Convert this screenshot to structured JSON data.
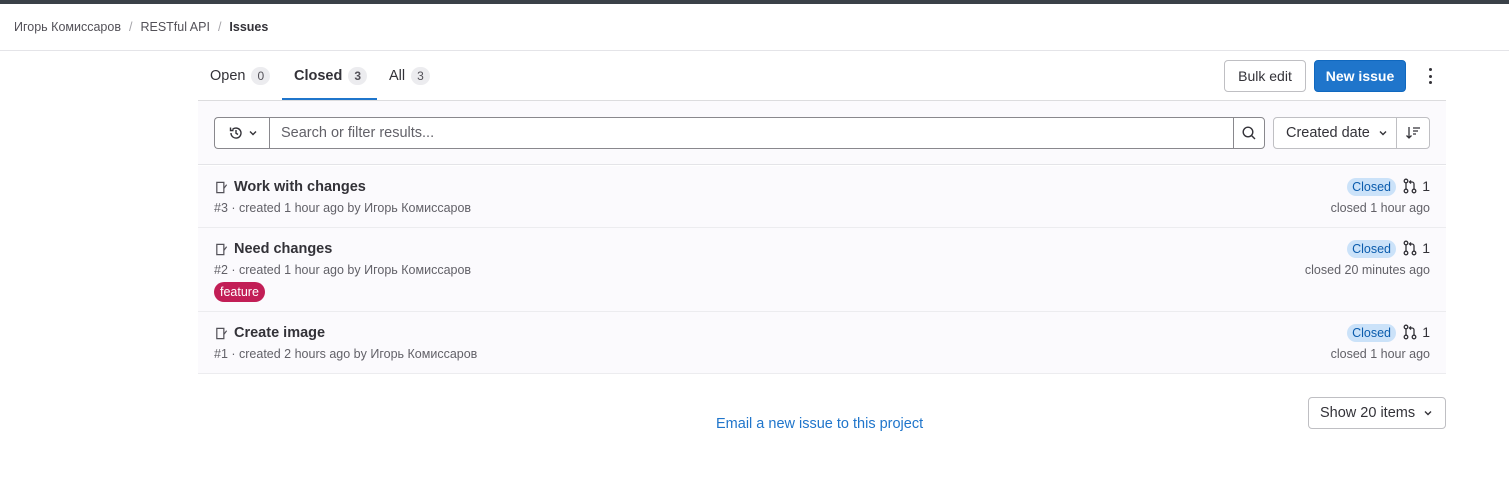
{
  "breadcrumb": {
    "items": [
      "Игорь Комиссаров",
      "RESTful API",
      "Issues"
    ],
    "separator": "/"
  },
  "tabs": [
    {
      "label": "Open",
      "count": "0",
      "active": false
    },
    {
      "label": "Closed",
      "count": "3",
      "active": true
    },
    {
      "label": "All",
      "count": "3",
      "active": false
    }
  ],
  "actions": {
    "bulk_edit": "Bulk edit",
    "new_issue": "New issue",
    "more_icon": "ellipsis-vertical-icon"
  },
  "filter": {
    "history_icon": "history-icon",
    "placeholder": "Search or filter results...",
    "value": "",
    "search_icon": "search-icon",
    "sort_label": "Created date",
    "sort_direction_icon": "sort-descending-icon"
  },
  "issues": [
    {
      "title": "Work with changes",
      "meta": "#3 · created 1 hour ago by Игорь Комиссаров",
      "status": "Closed",
      "mr_count": "1",
      "closed_time": "closed 1 hour ago",
      "labels": []
    },
    {
      "title": "Need changes",
      "meta": "#2 · created 1 hour ago by Игорь Комиссаров",
      "status": "Closed",
      "mr_count": "1",
      "closed_time": "closed 20 minutes ago",
      "labels": [
        "feature"
      ]
    },
    {
      "title": "Create image",
      "meta": "#1 · created 2 hours ago by Игорь Комиссаров",
      "status": "Closed",
      "mr_count": "1",
      "closed_time": "closed 1 hour ago",
      "labels": []
    }
  ],
  "colors": {
    "accent": "#1f75cb",
    "closed_badge_bg": "#cbe2f9",
    "closed_badge_text": "#0b5cad",
    "label_feature": "#c21e56"
  },
  "footer": {
    "email_link": "Email a new issue to this project",
    "page_size": "Show 20 items"
  }
}
